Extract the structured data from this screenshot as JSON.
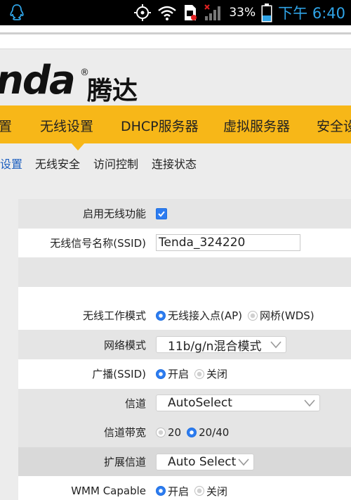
{
  "status_bar": {
    "battery_percent": "33%",
    "time": "下午 6:40",
    "icons": [
      "qq-icon",
      "gps-icon",
      "wifi-icon",
      "sim-card-icon",
      "signal-icon",
      "battery-icon"
    ]
  },
  "logo": {
    "text_en": "nda",
    "reg_mark": "®",
    "text_cn": "腾达"
  },
  "main_nav": {
    "items": [
      "置",
      "无线设置",
      "DHCP服务器",
      "虚拟服务器",
      "安全设"
    ]
  },
  "sub_nav": {
    "items": [
      "设置",
      "无线安全",
      "访问控制",
      "连接状态"
    ],
    "active_index": 0
  },
  "form": {
    "enable_wireless": {
      "label": "启用无线功能",
      "checked": true
    },
    "ssid": {
      "label": "无线信号名称(SSID)",
      "value": "Tenda_324220"
    },
    "work_mode": {
      "label": "无线工作模式",
      "options": [
        "无线接入点(AP)",
        "网桥(WDS)"
      ],
      "selected": 0
    },
    "network_mode": {
      "label": "网络模式",
      "value": "11b/g/n混合模式"
    },
    "broadcast": {
      "label": "广播(SSID)",
      "options": [
        "开启",
        "关闭"
      ],
      "selected": 0
    },
    "channel": {
      "label": "信道",
      "value": "AutoSelect"
    },
    "bandwidth": {
      "label": "信道带宽",
      "options": [
        "20",
        "20/40"
      ],
      "selected": 1
    },
    "ext_channel": {
      "label": "扩展信道",
      "value": "Auto Select"
    },
    "wmm": {
      "label": "WMM Capable",
      "options": [
        "开启",
        "关闭"
      ],
      "selected": 0
    }
  },
  "colors": {
    "nav_orange": "#f7b718",
    "accent_blue": "#2d7cf0",
    "time_blue": "#2fa4e7",
    "row_shade": "#e5e5e5"
  }
}
